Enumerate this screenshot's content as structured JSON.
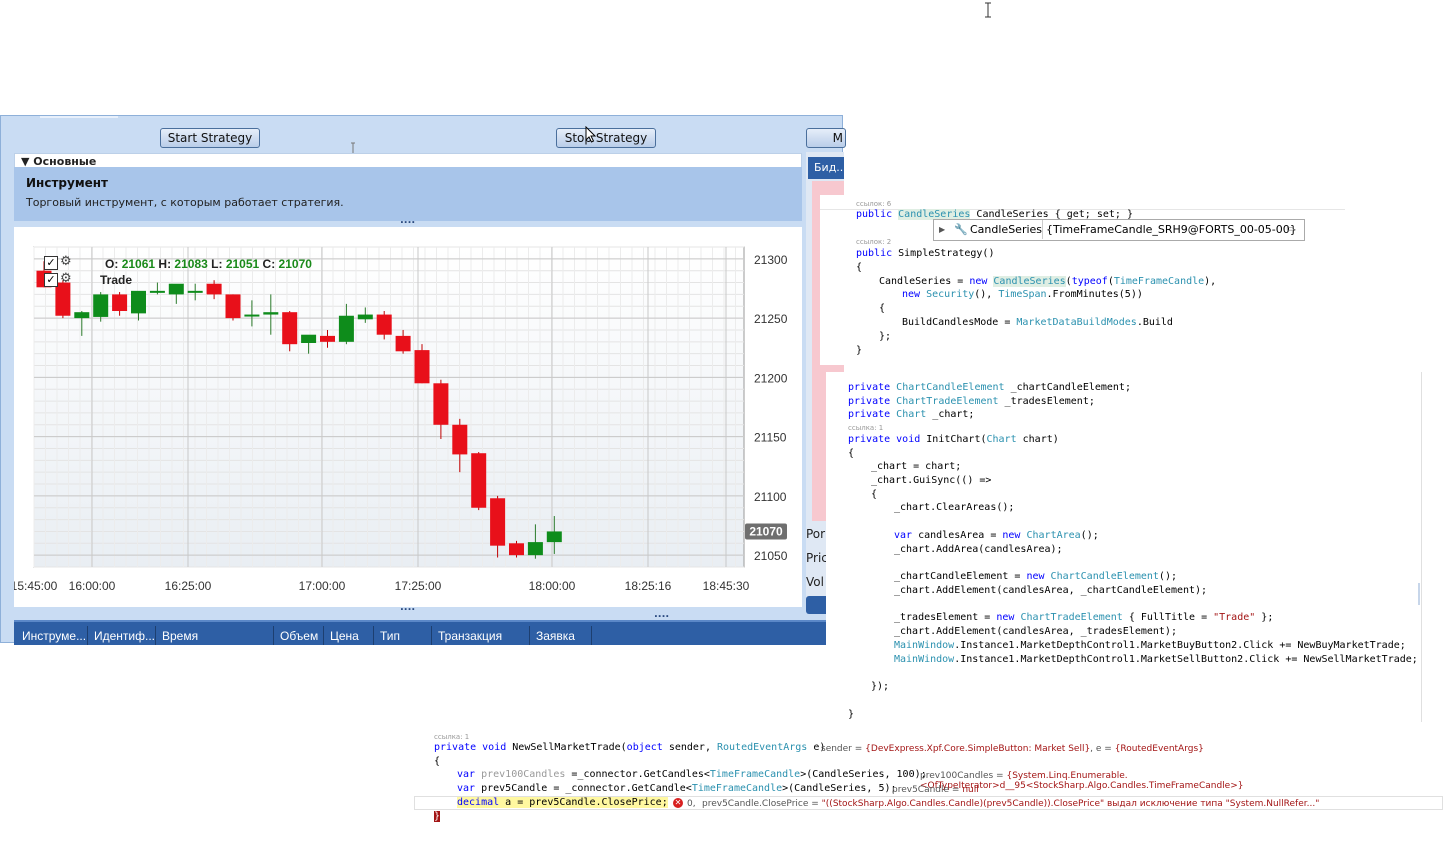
{
  "window": {
    "start_label": "Start Strategy",
    "stop_label": "Stop Strategy",
    "section_label": "▼ Основные",
    "desc_title": "Инструмент",
    "desc_text": "Торговый инструмент, с которым работает стратегия.",
    "right_labels": [
      "Бид...",
      "Por",
      "Pric",
      "Vol"
    ],
    "right_top_btn": "M"
  },
  "chart_data": {
    "type": "candlestick",
    "legend_ohlc": {
      "o_label": "O:",
      "o": "21061",
      "h_label": "H:",
      "h": "21083",
      "l_label": "L:",
      "l": "21051",
      "c_label": "C:",
      "c": "21070"
    },
    "legend_trade": "Trade",
    "ylim": [
      21040,
      21310
    ],
    "y_ticks": [
      "21300",
      "21250",
      "21200",
      "21150",
      "21100",
      "21050"
    ],
    "x_ticks": [
      "15:45:00",
      "16:00:00",
      "16:25:00",
      "17:00:00",
      "17:25:00",
      "18:00:00",
      "18:25:16",
      "18:45:30"
    ],
    "current_price": "21070",
    "candles": [
      {
        "o": 21290,
        "h": 21298,
        "l": 21276,
        "c": 21276
      },
      {
        "o": 21280,
        "h": 21282,
        "l": 21250,
        "c": 21252
      },
      {
        "o": 21250,
        "h": 21256,
        "l": 21235,
        "c": 21255
      },
      {
        "o": 21251,
        "h": 21272,
        "l": 21247,
        "c": 21270
      },
      {
        "o": 21270,
        "h": 21272,
        "l": 21252,
        "c": 21256
      },
      {
        "o": 21254,
        "h": 21262,
        "l": 21248,
        "c": 21273
      },
      {
        "o": 21273,
        "h": 21280,
        "l": 21270,
        "c": 21273
      },
      {
        "o": 21270,
        "h": 21275,
        "l": 21262,
        "c": 21279
      },
      {
        "o": 21273,
        "h": 21279,
        "l": 21265,
        "c": 21273
      },
      {
        "o": 21279,
        "h": 21282,
        "l": 21266,
        "c": 21270
      },
      {
        "o": 21270,
        "h": 21270,
        "l": 21248,
        "c": 21250
      },
      {
        "o": 21252,
        "h": 21265,
        "l": 21243,
        "c": 21253
      },
      {
        "o": 21253,
        "h": 21270,
        "l": 21236,
        "c": 21255
      },
      {
        "o": 21255,
        "h": 21256,
        "l": 21222,
        "c": 21228
      },
      {
        "o": 21229,
        "h": 21233,
        "l": 21220,
        "c": 21236
      },
      {
        "o": 21235,
        "h": 21240,
        "l": 21225,
        "c": 21230
      },
      {
        "o": 21230,
        "h": 21262,
        "l": 21228,
        "c": 21252
      },
      {
        "o": 21249,
        "h": 21259,
        "l": 21246,
        "c": 21253
      },
      {
        "o": 21253,
        "h": 21256,
        "l": 21232,
        "c": 21236
      },
      {
        "o": 21235,
        "h": 21240,
        "l": 21220,
        "c": 21222
      },
      {
        "o": 21223,
        "h": 21228,
        "l": 21195,
        "c": 21195
      },
      {
        "o": 21195,
        "h": 21198,
        "l": 21148,
        "c": 21160
      },
      {
        "o": 21160,
        "h": 21165,
        "l": 21120,
        "c": 21135
      },
      {
        "o": 21136,
        "h": 21137,
        "l": 21088,
        "c": 21090
      },
      {
        "o": 21098,
        "h": 21100,
        "l": 21048,
        "c": 21058
      },
      {
        "o": 21060,
        "h": 21062,
        "l": 21048,
        "c": 21050
      },
      {
        "o": 21050,
        "h": 21076,
        "l": 21047,
        "c": 21061
      },
      {
        "o": 21061,
        "h": 21083,
        "l": 21051,
        "c": 21070
      }
    ]
  },
  "table_headers": [
    "Инструме...",
    "Идентиф...",
    "Время",
    "Объем",
    "Цена",
    "Тип",
    "Транзакция",
    "Заявка"
  ],
  "code_top": {
    "ref6": "ссылок: 6",
    "line1_kw": "public",
    "line1_type": "CandleSeries",
    "line1_rest": " CandleSeries { get; set; }",
    "tooltip_name": "CandleSeries",
    "tooltip_value": "{TimeFrameCandle_SRH9@FORTS_00-05-00}",
    "ref2": "ссылок: 2",
    "l_ctor": "public SimpleStrategy()",
    "l_brace": "{",
    "l_a1": "CandleSeries = ",
    "l_a2": "new ",
    "l_a3": "CandleSeries",
    "l_a4": "(",
    "l_a5": "typeof",
    "l_a6": "(",
    "l_a7": "TimeFrameCandle",
    "l_a8": "),",
    "l_b1": "new ",
    "l_b2": "Security",
    "l_b3": "(), ",
    "l_b4": "TimeSpan",
    "l_b5": ".FromMinutes(5))",
    "l_c": "{",
    "l_d1": "BuildCandlesMode = ",
    "l_d2": "MarketDataBuildModes",
    "l_d3": ".Build",
    "l_e": "};",
    "l_f": "}"
  },
  "code_mid": {
    "l1_kw": "private ",
    "l1_ty": "ChartCandleElement",
    "l1_rest": " _chartCandleElement;",
    "l2_kw": "private ",
    "l2_ty": "ChartTradeElement",
    "l2_rest": " _tradesElement;",
    "l3_kw": "private ",
    "l3_ty": "Chart",
    "l3_rest": " _chart;",
    "ref1": "ссылка: 1",
    "l4_kw": "private void ",
    "l4_rest": "InitChart(",
    "l4_ty": "Chart",
    "l4_rest2": " chart)",
    "l5": "{",
    "l6": "_chart = chart;",
    "l7": "_chart.GuiSync(() =>",
    "l8": "{",
    "l9": "_chart.ClearAreas();",
    "l10_kw": "var ",
    "l10_a": "candlesArea = ",
    "l10_new": "new ",
    "l10_ty": "ChartArea",
    "l10_b": "();",
    "l11": "_chart.AddArea(candlesArea);",
    "l12_a": "_chartCandleElement = ",
    "l12_new": "new ",
    "l12_ty": "ChartCandleElement",
    "l12_b": "();",
    "l13": "_chart.AddElement(candlesArea, _chartCandleElement);",
    "l14_a": "_tradesElement = ",
    "l14_new": "new ",
    "l14_ty": "ChartTradeElement",
    "l14_b": " { FullTitle = ",
    "l14_str": "\"Trade\"",
    "l14_c": " };",
    "l15": "_chart.AddElement(candlesArea, _tradesElement);",
    "l16_ty": "MainWindow",
    "l16_rest": ".Instance1.MarketDepthControl1.MarketBuyButton2.Click += NewBuyMarketTrade;",
    "l17_ty": "MainWindow",
    "l17_rest": ".Instance1.MarketDepthControl1.MarketSellButton2.Click += NewSellMarketTrade;",
    "l18": "});",
    "l19": "}"
  },
  "code_bottom": {
    "ref1": "ссылка: 1",
    "l1_kw": "private void ",
    "l1_a": "NewSellMarketTrade(",
    "l1_kw2": "object",
    "l1_b": " sender, ",
    "l1_ty": "RoutedEventArgs",
    "l1_c": " e)",
    "l1_dbg_a": "sender = ",
    "l1_dbg_av": "{DevExpress.Xpf.Core.SimpleButton: Market Sell}",
    "l1_dbg_b": ",   e = ",
    "l1_dbg_bv": "{RoutedEventArgs}",
    "l2": "{",
    "l3_kw": "var ",
    "l3_dim": "prev100Candles",
    "l3_a": " =_connector.GetCandles<",
    "l3_ty": "TimeFrameCandle",
    "l3_b": ">(CandleSeries, 100);",
    "l3_dbg": "prev100Candles = ",
    "l3_dbgv": "{System.Linq.Enumerable.<OfTypeIterator>d__95<StockSharp.Algo.Candles.TimeFrameCandle>}",
    "l4_kw": "var ",
    "l4_a": "prev5Candle = _connector.GetCandle<",
    "l4_ty": "TimeFrameCandle",
    "l4_b": ">(CandleSeries, 5);",
    "l4_dbg": "prev5Candle = ",
    "l4_dbgv": "null",
    "l5_kw": "decimal ",
    "l5_a": "a = prev5Candle.ClosePrice;",
    "l5_err_num": "0,",
    "l5_dbg": "prev5Candle.ClosePrice = ",
    "l5_dbgv": "\"((StockSharp.Algo.Candles.Candle)(prev5Candle)).ClosePrice\" выдал исключение типа \"System.NullRefer...\"",
    "l6": "}"
  }
}
